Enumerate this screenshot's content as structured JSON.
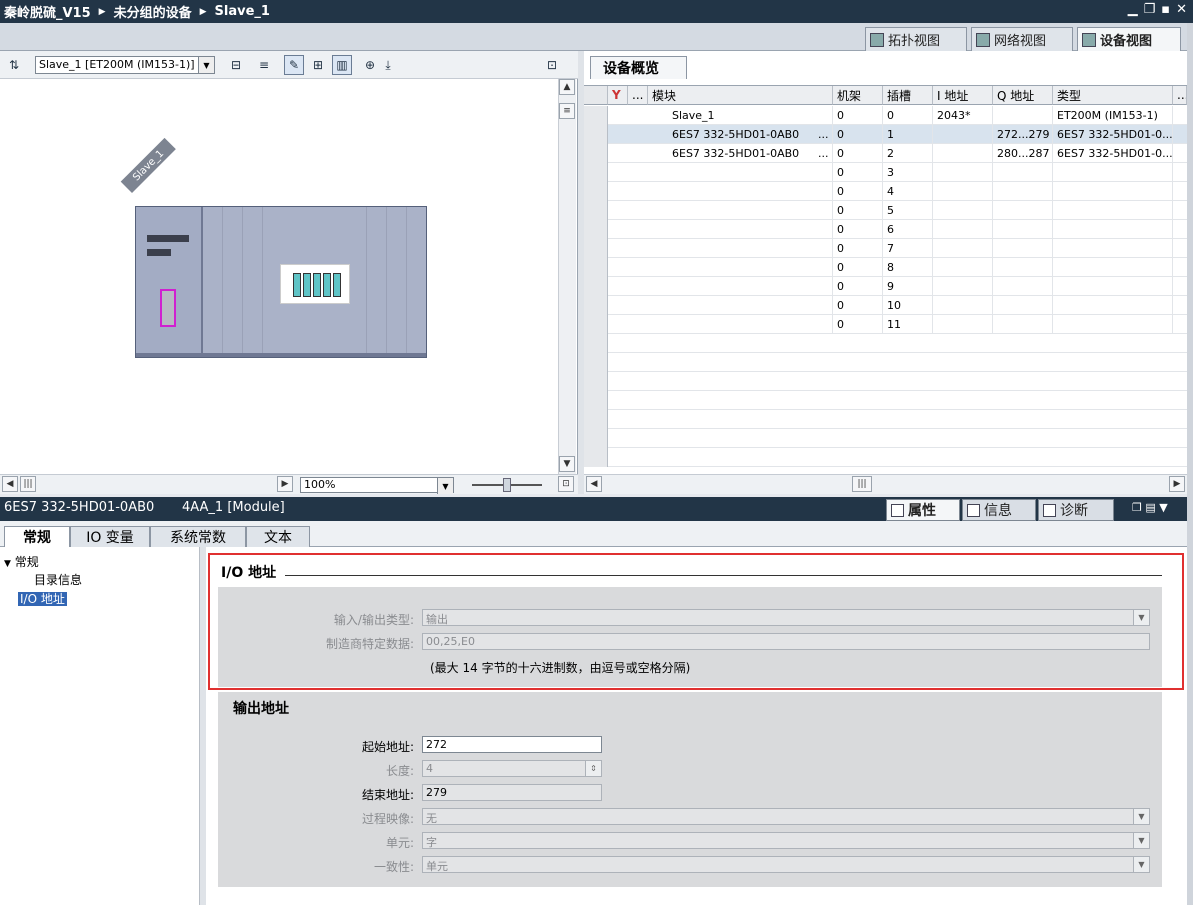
{
  "titlebar": {
    "project": "秦岭脱硫_V15",
    "group": "未分组的设备",
    "device": "Slave_1",
    "controls": [
      "▁",
      "❐",
      "▪",
      "✕"
    ]
  },
  "viewtabs": {
    "topology": "拓扑视图",
    "network": "网络视图",
    "device": "设备视图"
  },
  "left_toolbar": {
    "device_select": "Slave_1 [ET200M (IM153-1)]"
  },
  "canvas": {
    "rack_label": "Slave_1",
    "zoom": "100%"
  },
  "overview": {
    "tab_label": "设备概览",
    "columns": [
      "",
      "...",
      "模块",
      "机架",
      "插槽",
      "I 地址",
      "Q 地址",
      "类型",
      "..."
    ],
    "rows": [
      {
        "module": "Slave_1",
        "rack": "0",
        "slot": "0",
        "i_addr": "2043*",
        "q_addr": "",
        "type": "ET200M (IM153-1)",
        "more": ""
      },
      {
        "module": "6ES7 332-5HD01-0AB0",
        "rack": "0",
        "slot": "1",
        "i_addr": "",
        "q_addr": "272...279",
        "type": "6ES7 332-5HD01-0...",
        "more": "..."
      },
      {
        "module": "6ES7 332-5HD01-0AB0",
        "rack": "0",
        "slot": "2",
        "i_addr": "",
        "q_addr": "280...287",
        "type": "6ES7 332-5HD01-0...",
        "more": "..."
      },
      {
        "module": "",
        "rack": "0",
        "slot": "3",
        "i_addr": "",
        "q_addr": "",
        "type": "",
        "more": ""
      },
      {
        "module": "",
        "rack": "0",
        "slot": "4",
        "i_addr": "",
        "q_addr": "",
        "type": "",
        "more": ""
      },
      {
        "module": "",
        "rack": "0",
        "slot": "5",
        "i_addr": "",
        "q_addr": "",
        "type": "",
        "more": ""
      },
      {
        "module": "",
        "rack": "0",
        "slot": "6",
        "i_addr": "",
        "q_addr": "",
        "type": "",
        "more": ""
      },
      {
        "module": "",
        "rack": "0",
        "slot": "7",
        "i_addr": "",
        "q_addr": "",
        "type": "",
        "more": ""
      },
      {
        "module": "",
        "rack": "0",
        "slot": "8",
        "i_addr": "",
        "q_addr": "",
        "type": "",
        "more": ""
      },
      {
        "module": "",
        "rack": "0",
        "slot": "9",
        "i_addr": "",
        "q_addr": "",
        "type": "",
        "more": ""
      },
      {
        "module": "",
        "rack": "0",
        "slot": "10",
        "i_addr": "",
        "q_addr": "",
        "type": "",
        "more": ""
      },
      {
        "module": "",
        "rack": "0",
        "slot": "11",
        "i_addr": "",
        "q_addr": "",
        "type": "",
        "more": ""
      }
    ],
    "dots_first": "..."
  },
  "inspector": {
    "module_order": "6ES7 332-5HD01-0AB0",
    "module_name": "4AA_1 [Module]",
    "tabs": {
      "properties": "属性",
      "info": "信息",
      "diagnostics": "诊断"
    },
    "prop_tabs": [
      "常规",
      "IO 变量",
      "系统常数",
      "文本"
    ],
    "tree": {
      "general": "常规",
      "catalog": "目录信息",
      "io_address": "I/O 地址"
    },
    "io_section": {
      "title": "I/O 地址",
      "io_type_label": "输入/输出类型:",
      "io_type_value": "输出",
      "mfr_label": "制造商特定数据:",
      "mfr_value": "00,25,E0",
      "hint": "(最大 14 字节的十六进制数，由逗号或空格分隔)"
    },
    "output_section": {
      "title": "输出地址",
      "start_label": "起始地址:",
      "start_value": "272",
      "length_label": "长度:",
      "length_value": "4",
      "end_label": "结束地址:",
      "end_value": "279",
      "image_label": "过程映像:",
      "image_value": "无",
      "unit_label": "单元:",
      "unit_value": "字",
      "consistency_label": "一致性:",
      "consistency_value": "单元"
    }
  },
  "colors": {
    "titlebar": "#223547",
    "highlight": "#e03030",
    "selection": "#3266b4",
    "port_highlight": "#d020d0"
  }
}
